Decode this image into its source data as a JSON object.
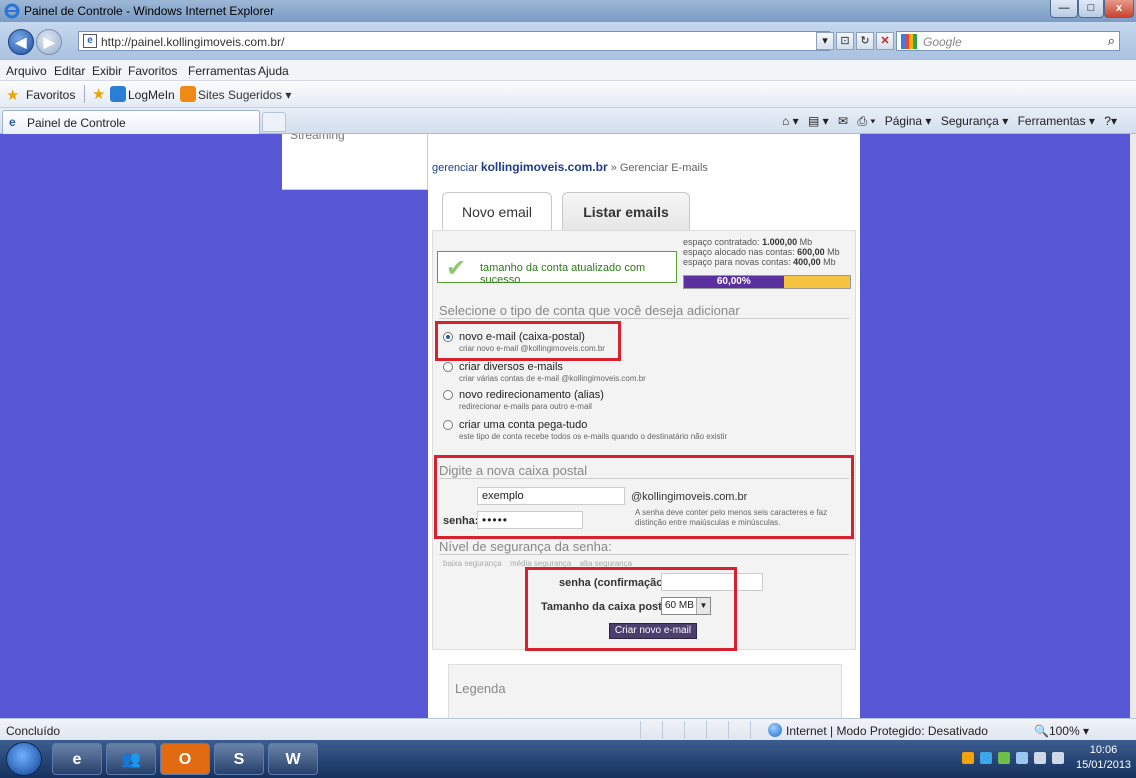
{
  "window": {
    "title": "Painel de Controle - Windows Internet Explorer",
    "min": "—",
    "max": "□",
    "close": "x"
  },
  "address": {
    "back": "◀",
    "forward": "▶",
    "url": "http://painel.kollingimoveis.com.br/",
    "search_placeholder": "Google"
  },
  "menu": [
    "Arquivo",
    "Editar",
    "Exibir",
    "Favoritos",
    "Ferramentas",
    "Ajuda"
  ],
  "favorites": {
    "label": "Favoritos",
    "items": [
      "LogMeIn",
      "Sites Sugeridos ▾"
    ]
  },
  "tab": {
    "label": "Painel de Controle"
  },
  "commands": [
    "Página ▾",
    "Segurança ▾",
    "Ferramentas ▾"
  ],
  "page": {
    "left_item": "Streaming",
    "breadcrumb": {
      "prefix": "gerenciar",
      "domain": "kollingimoveis.com.br",
      "sep": "»",
      "current": "Gerenciar E-mails"
    },
    "tabs": [
      "Novo email",
      "Listar emails"
    ],
    "success": "tamanho da conta atualizado com sucesso",
    "quota": {
      "contracted_label": "espaço contratado:",
      "contracted": "1.000,00",
      "allocated_label": "espaço alocado nas contas:",
      "allocated": "600,00",
      "free_label": "espaço para novas contas:",
      "free": "400,00",
      "unit": "Mb",
      "percent_label": "60,00%",
      "percent": 60
    },
    "section1": "Selecione o tipo de conta que você deseja adicionar",
    "options": [
      {
        "label": "novo e-mail (caixa-postal)",
        "sub": "criar novo e-mail @kollingimoveis.com.br",
        "selected": true
      },
      {
        "label": "criar diversos e-mails",
        "sub": "criar várias contas de e-mail @kollingimoveis.com.br",
        "selected": false
      },
      {
        "label": "novo redirecionamento (alias)",
        "sub": "redirecionar e-mails para outro e-mail",
        "selected": false
      },
      {
        "label": "criar uma conta pega-tudo",
        "sub": "este tipo de conta recebe todos os e-mails quando o destinatário não existir",
        "selected": false
      }
    ],
    "section2": "Digite a nova caixa postal",
    "mailbox_value": "exemplo",
    "domain_suffix": "@kollingimoveis.com.br",
    "password_label": "senha:",
    "password_value": "•••••",
    "password_hint": "A senha deve conter pelo menos seis caracteres e faz distinção entre maiúsculas e minúsculas.",
    "section3": "Nível de segurança da senha:",
    "strength": [
      "baixa segurança",
      "média segurança",
      "alta segurança"
    ],
    "confirm_label": "senha (confirmação):",
    "size_label": "Tamanho da caixa postal:",
    "size_value": "60 MB",
    "create_button": "Criar novo e-mail",
    "legend": "Legenda"
  },
  "status": {
    "text": "Concluído",
    "zone": "Internet | Modo Protegido: Desativado",
    "zoom": "🔍100% ▾"
  },
  "taskbar": {
    "time": "10:06",
    "date": "15/01/2013"
  },
  "colors": {
    "page_bg": "#5858d6",
    "highlight": "#d8212e",
    "quota_used": "#5a2f9e",
    "quota_free": "#f5c542"
  }
}
